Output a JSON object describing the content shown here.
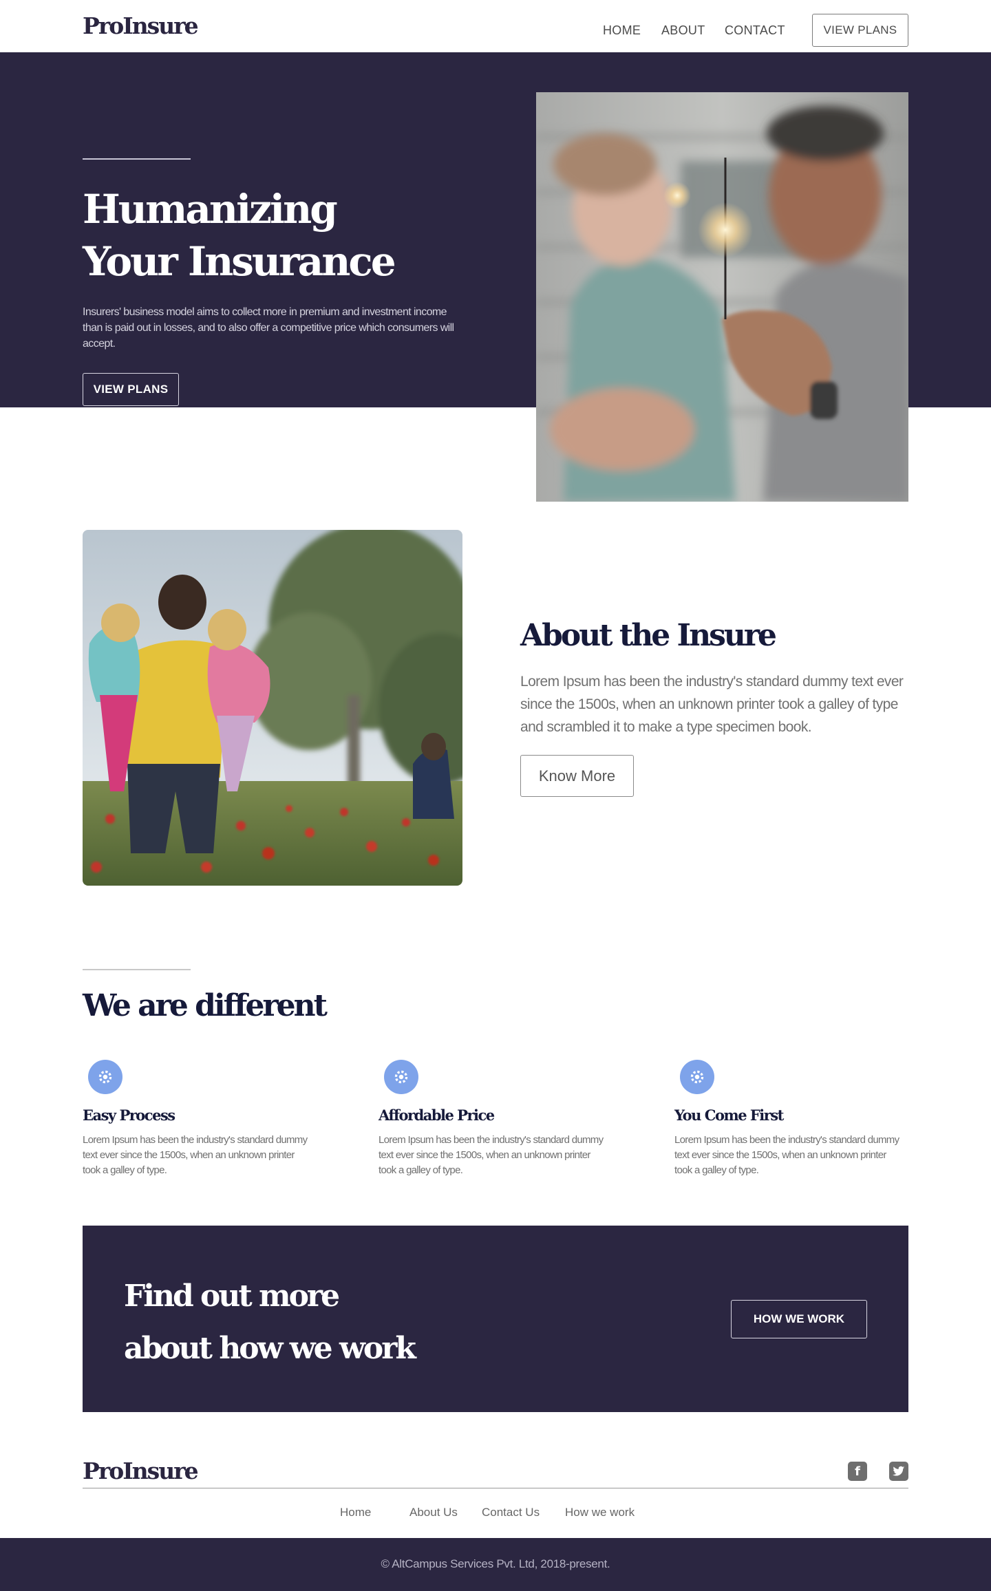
{
  "header": {
    "logo": "ProInsure",
    "nav": [
      "HOME",
      "ABOUT",
      "CONTACT"
    ],
    "cta_label": "VIEW PLANS"
  },
  "hero": {
    "title_line1": "Humanizing",
    "title_line2": "Your Insurance",
    "description": "Insurers' business model aims to collect more in premium and investment income than is paid out in losses, and to also offer a competitive price which consumers will accept.",
    "button_label": "VIEW PLANS",
    "photo_subject": "father-and-child-with-sparkler"
  },
  "about": {
    "title": "About the Insure",
    "description": "Lorem Ipsum has been the industry's standard dummy text ever since the 1500s, when an unknown printer took a galley of type and scrambled it to make a type specimen book.",
    "button_label": "Know More",
    "photo_subject": "father-carrying-children-in-poppy-field"
  },
  "different": {
    "title": "We are different",
    "features": [
      {
        "title": "Easy Process",
        "description": "Lorem Ipsum has been the industry's standard dummy text ever since the 1500s, when an unknown printer took a galley of type.",
        "icon": "gear-icon"
      },
      {
        "title": "Affordable Price",
        "description": "Lorem Ipsum has been the industry's standard dummy text ever since the 1500s, when an unknown printer took a galley of type.",
        "icon": "gear-icon"
      },
      {
        "title": "You Come First",
        "description": "Lorem Ipsum has been the industry's standard dummy text ever since the 1500s, when an unknown printer took a galley of type.",
        "icon": "gear-icon"
      }
    ]
  },
  "cta": {
    "title_line1": "Find out more",
    "title_line2": "about how we work",
    "button_label": "HOW WE WORK"
  },
  "footer": {
    "logo": "ProInsure",
    "social": [
      "facebook-icon",
      "twitter-icon"
    ],
    "links": [
      "Home",
      "About Us",
      "Contact Us",
      "How we work"
    ],
    "copyright": "© AltCampus Services Pvt. Ltd, 2018-present."
  },
  "colors": {
    "primary_dark": "#2b2641",
    "accent_blue": "#7ea3ea",
    "heading_navy": "#161a3a"
  }
}
